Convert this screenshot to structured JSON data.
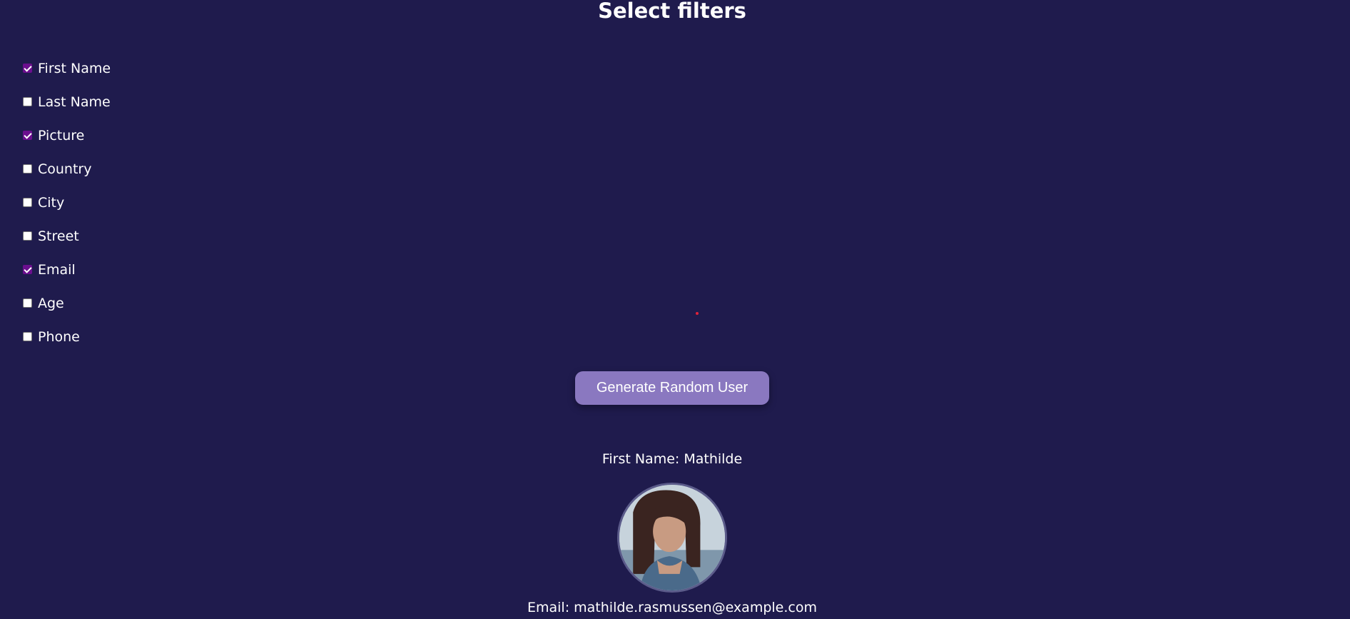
{
  "header": {
    "title": "Select filters"
  },
  "filters": [
    {
      "label": "First Name",
      "checked": true
    },
    {
      "label": "Last Name",
      "checked": false
    },
    {
      "label": "Picture",
      "checked": true
    },
    {
      "label": "Country",
      "checked": false
    },
    {
      "label": "City",
      "checked": false
    },
    {
      "label": "Street",
      "checked": false
    },
    {
      "label": "Email",
      "checked": true
    },
    {
      "label": "Age",
      "checked": false
    },
    {
      "label": "Phone",
      "checked": false
    }
  ],
  "actions": {
    "generate_label": "Generate Random User"
  },
  "result": {
    "first_name_line": "First Name: Mathilde",
    "email_line": "Email: mathilde.rasmussen@example.com",
    "avatar_icon": "user-photo"
  },
  "colors": {
    "background": "#1f1b4d",
    "button": "#8a78c0",
    "checkbox_checked": "#6b0f8e",
    "text": "#ffffff"
  }
}
